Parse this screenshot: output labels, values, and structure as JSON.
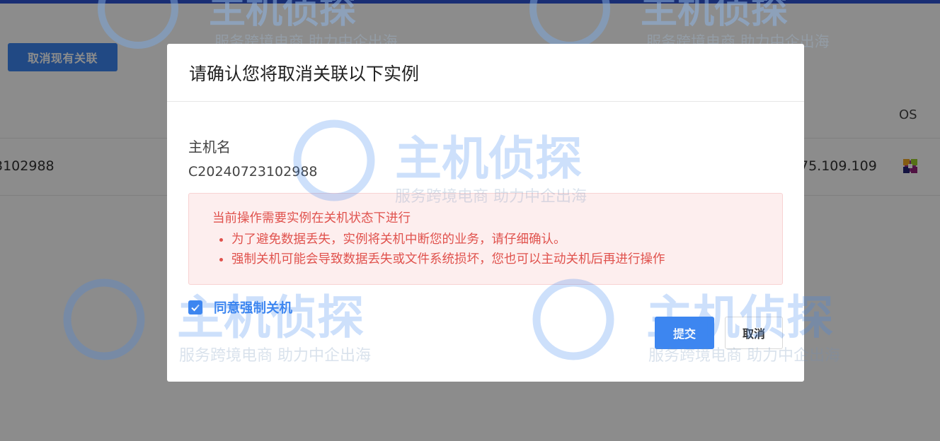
{
  "background": {
    "detach_all_label": "取消现有关联",
    "columns": {
      "os": "OS"
    },
    "row": {
      "hostname": "3102988",
      "ip": "75.109.109"
    }
  },
  "watermark": {
    "brand": "主机侦探",
    "slogan": "服务跨境电商 助力中企出海"
  },
  "dialog": {
    "title": "请确认您将取消关联以下实例",
    "field_label": "主机名",
    "field_value": "C20240723102988",
    "alert": {
      "title": "当前操作需要实例在关机状态下进行",
      "items": [
        "为了避免数据丢失，实例将关机中断您的业务，请仔细确认。",
        "强制关机可能会导致数据丢失或文件系统损坏，您也可以主动关机后再进行操作"
      ]
    },
    "agree_label": "同意强制关机",
    "agree_checked": true,
    "submit_label": "提交",
    "cancel_label": "取消"
  },
  "colors": {
    "primary": "#3d86f0",
    "alert_text": "#e0524d",
    "alert_bg": "#fdeeee",
    "top_bar": "#2f55d4"
  }
}
